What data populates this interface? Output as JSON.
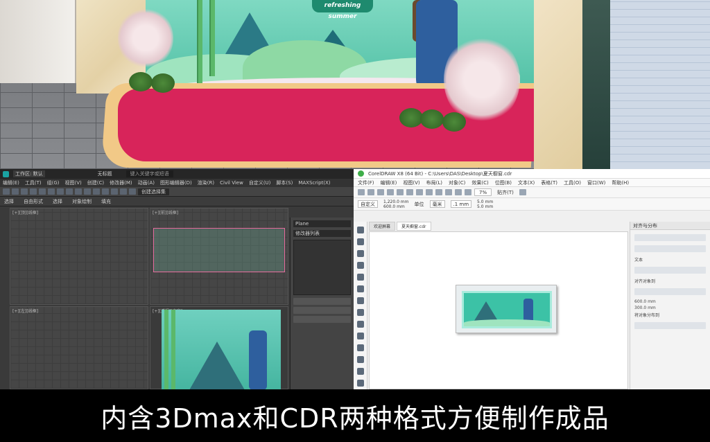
{
  "render": {
    "banner_text": "refreshing summer"
  },
  "max": {
    "title": "无标题",
    "search_placeholder": "键入关键字或短语",
    "workspace_label": "工作区: 默认",
    "menu": [
      "编辑(E)",
      "工具(T)",
      "组(G)",
      "视图(V)",
      "创建(C)",
      "修改器(M)",
      "动画(A)",
      "图形编辑器(D)",
      "渲染(R)",
      "Civil View",
      "自定义(U)",
      "脚本(S)",
      "MAXScript(X)"
    ],
    "selection_set": "创建选择集",
    "ribbon_tabs": [
      "选择",
      "自由形式",
      "选择",
      "对象绘制",
      "填充"
    ],
    "viewports": {
      "top_left": "[+][顶][线框]",
      "top_right": "[+][前][线框]",
      "bottom_left": "[+][左][线框]",
      "bottom_right": "[+][透视][真实]"
    },
    "cmd_panel": {
      "name_label": "Plane",
      "modifier_list": "修改器列表"
    }
  },
  "cdr": {
    "title": "CorelDRAW X8 (64 Bit) - C:\\Users\\DAS\\Desktop\\夏天橱窗.cdr",
    "menu": [
      "文件(F)",
      "编辑(E)",
      "视图(V)",
      "布局(L)",
      "对象(C)",
      "效果(C)",
      "位图(B)",
      "文本(X)",
      "表格(T)",
      "工具(O)",
      "窗口(W)",
      "帮助(H)"
    ],
    "zoom": "7%",
    "snap_label": "贴齐(T)",
    "page_preset": "自定义",
    "width": "1,220.0 mm",
    "height": "600.0 mm",
    "unit_label": "单位",
    "unit_value": "毫米",
    "nudge": ".1 mm",
    "dup_x": "5.0 mm",
    "dup_y": "5.0 mm",
    "tabs": [
      "欢迎屏幕",
      "夏天橱窗.cdr"
    ],
    "docker_title": "对齐与分布",
    "docker_values": {
      "text_label": "文本",
      "align_to": "对齐对象到",
      "x_val": "600.0 mm",
      "y_val": "300.0 mm",
      "distribute_to": "将对象分布到"
    }
  },
  "caption": "内含3Dmax和CDR两种格式方便制作成品"
}
